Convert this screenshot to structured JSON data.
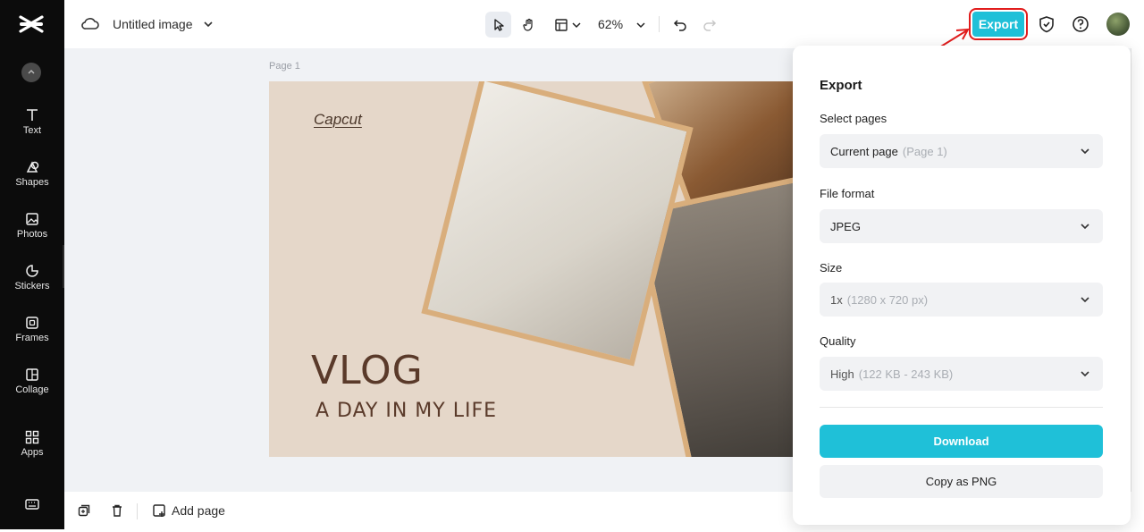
{
  "app": {
    "document_title": "Untitled image",
    "zoom_level": "62%",
    "export_button": "Export",
    "accent_color": "#1fc0d8"
  },
  "sidebar": {
    "items": [
      {
        "label": "Text",
        "icon": "text-icon"
      },
      {
        "label": "Shapes",
        "icon": "shapes-icon"
      },
      {
        "label": "Photos",
        "icon": "photos-icon"
      },
      {
        "label": "Stickers",
        "icon": "stickers-icon"
      },
      {
        "label": "Frames",
        "icon": "frames-icon"
      },
      {
        "label": "Collage",
        "icon": "collage-icon"
      },
      {
        "label": "Apps",
        "icon": "apps-icon"
      }
    ]
  },
  "canvas": {
    "page_label": "Page 1",
    "slide": {
      "brand": "Capcut",
      "headline": "VLOG",
      "subheadline": "A DAY IN MY LIFE"
    }
  },
  "bottombar": {
    "add_page": "Add page"
  },
  "export_panel": {
    "title": "Export",
    "select_pages_label": "Select pages",
    "select_pages_value": "Current page",
    "select_pages_hint": "(Page 1)",
    "file_format_label": "File format",
    "file_format_value": "JPEG",
    "size_label": "Size",
    "size_value": "1x",
    "size_hint": "(1280 x 720 px)",
    "quality_label": "Quality",
    "quality_value": "High",
    "quality_hint": "(122 KB - 243 KB)",
    "download_label": "Download",
    "copy_label": "Copy as PNG"
  }
}
